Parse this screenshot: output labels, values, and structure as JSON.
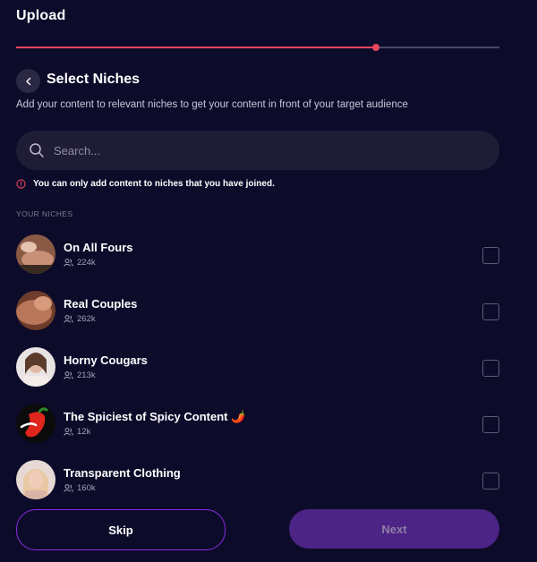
{
  "header": {
    "title": "Upload",
    "progress_fraction": 0.745,
    "accent": "#e8455e"
  },
  "step": {
    "heading": "Select Niches",
    "subtitle": "Add your content to relevant niches to get your content in front of your target audience"
  },
  "search": {
    "placeholder": "Search..."
  },
  "notice": "You can only add content to niches that you have joined.",
  "section_label": "YOUR NICHES",
  "niches": [
    {
      "name": "On All Fours",
      "members": "224k",
      "checked": false
    },
    {
      "name": "Real Couples",
      "members": "262k",
      "checked": false
    },
    {
      "name": "Horny Cougars",
      "members": "213k",
      "checked": false
    },
    {
      "name": "The Spiciest of Spicy Content 🌶️",
      "members": "12k",
      "checked": false
    },
    {
      "name": "Transparent Clothing",
      "members": "160k",
      "checked": false
    }
  ],
  "footer": {
    "skip_label": "Skip",
    "next_label": "Next"
  },
  "colors": {
    "background": "#0d0b2a",
    "skip_border": "#8a2be2",
    "next_bg": "#4c2485"
  }
}
